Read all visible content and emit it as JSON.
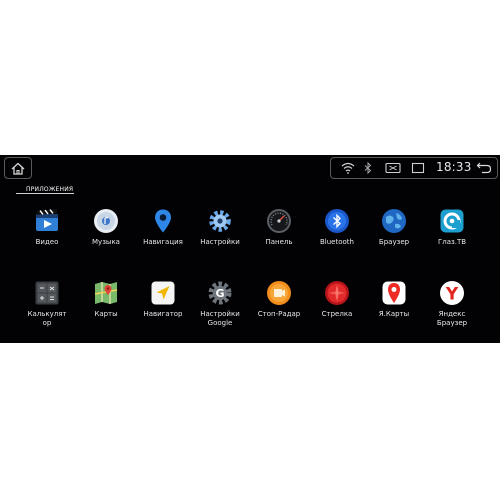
{
  "status": {
    "time": "18:33"
  },
  "tab": {
    "label": "ПРИЛОЖЕНИЯ"
  },
  "apps": [
    {
      "label": "Видео",
      "icon": "video-icon"
    },
    {
      "label": "Музыка",
      "icon": "music-icon"
    },
    {
      "label": "Навигация",
      "icon": "navigation-pin-icon"
    },
    {
      "label": "Настройки",
      "icon": "settings-gear-icon"
    },
    {
      "label": "Панель",
      "icon": "dashboard-gauge-icon"
    },
    {
      "label": "Bluetooth",
      "icon": "bluetooth-icon"
    },
    {
      "label": "Браузер",
      "icon": "browser-globe-icon"
    },
    {
      "label": "Глаз.ТВ",
      "icon": "glaz-tv-icon"
    },
    {
      "label": "Калькулят\nор",
      "icon": "calculator-icon"
    },
    {
      "label": "Карты",
      "icon": "maps-icon"
    },
    {
      "label": "Навигатор",
      "icon": "navigator-arrow-icon"
    },
    {
      "label": "Настройки\nGoogle",
      "icon": "google-settings-icon"
    },
    {
      "label": "Стоп-Радар",
      "icon": "stop-radar-icon"
    },
    {
      "label": "Стрелка",
      "icon": "strelka-icon"
    },
    {
      "label": "Я.Карты",
      "icon": "yandex-maps-icon"
    },
    {
      "label": "Яндекс\nБраузер",
      "icon": "yandex-browser-icon"
    }
  ]
}
